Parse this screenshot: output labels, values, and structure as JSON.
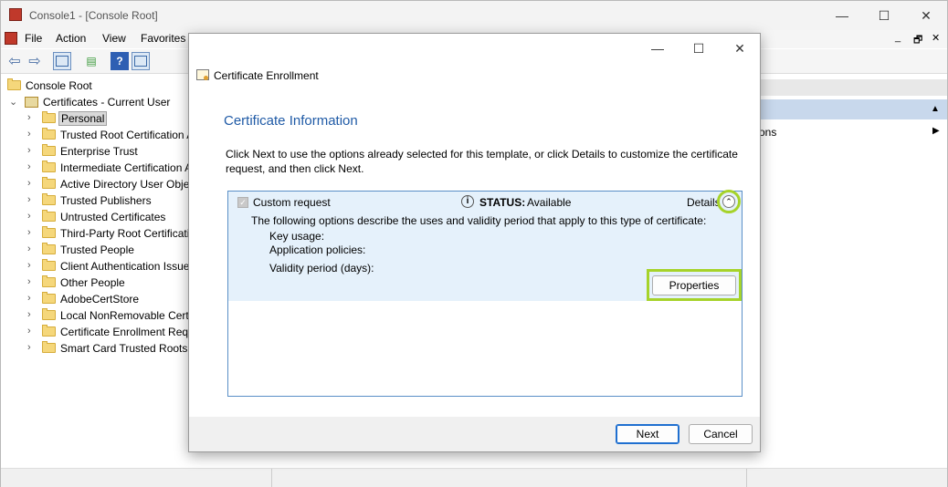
{
  "mmc": {
    "title": "Console1 - [Console Root]",
    "window_controls": {
      "minimize": "—",
      "maximize": "☐",
      "close": "✕"
    },
    "menu": [
      "File",
      "Action",
      "View",
      "Favorites"
    ],
    "mdi_controls": {
      "minimize": "_",
      "restore": "🗗",
      "close": "✕"
    },
    "tree": {
      "root": "Console Root",
      "store": "Certificates - Current User",
      "items": [
        "Personal",
        "Trusted Root Certification A",
        "Enterprise Trust",
        "Intermediate Certification A",
        "Active Directory User Objec",
        "Trusted Publishers",
        "Untrusted Certificates",
        "Third-Party Root Certificatio",
        "Trusted People",
        "Client Authentication Issue",
        "Other People",
        "AdobeCertStore",
        "Local NonRemovable Certi",
        "Certificate Enrollment Requ",
        "Smart Card Trusted Roots"
      ]
    },
    "actions": {
      "more_actions_fragment": "ons"
    }
  },
  "dialog": {
    "window_controls": {
      "minimize": "—",
      "maximize": "☐",
      "close": "✕"
    },
    "app_title": "Certificate Enrollment",
    "heading": "Certificate Information",
    "intro_line1": "Click Next to use the options already selected for this template, or click Details to customize the certificate",
    "intro_line2": "request, and then click Next.",
    "request": {
      "name": "Custom request",
      "status_label": "STATUS:",
      "status_value": "Available",
      "details_label": "Details",
      "description": "The following options describe the uses and validity period that apply to this type of certificate:",
      "key_usage_label": "Key usage:",
      "app_policies_label": "Application policies:",
      "validity_label": "Validity period (days):",
      "properties_button": "Properties"
    },
    "next_button": "Next",
    "cancel_button": "Cancel"
  },
  "colors": {
    "heading": "#1f5aa6",
    "highlight": "#a6d32a",
    "panel_fill": "#e5f1fb",
    "panel_border": "#5a8fc7"
  }
}
